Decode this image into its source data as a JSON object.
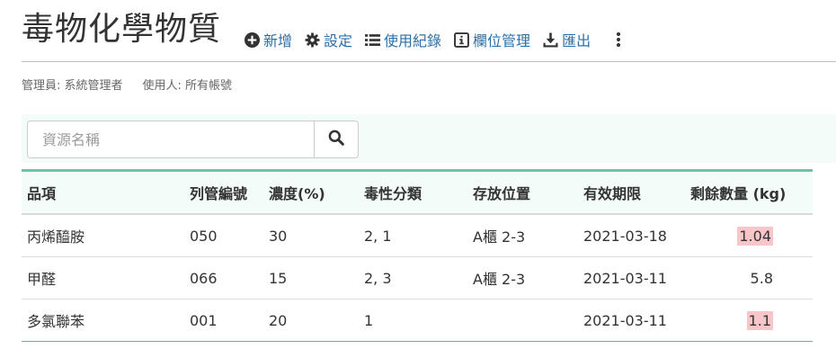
{
  "header": {
    "title": "毒物化學物質"
  },
  "toolbar": {
    "items": [
      {
        "label": "新增",
        "icon": "plus-circle-icon"
      },
      {
        "label": "設定",
        "icon": "gear-icon"
      },
      {
        "label": "使用紀錄",
        "icon": "list-icon"
      },
      {
        "label": "欄位管理",
        "icon": "info-icon"
      },
      {
        "label": "匯出",
        "icon": "download-icon"
      }
    ],
    "more_icon": "vertical-ellipsis-icon"
  },
  "meta": {
    "admin": "管理員: 系統管理者",
    "user": "使用人: 所有帳號"
  },
  "search": {
    "placeholder": "資源名稱",
    "icon": "search-icon"
  },
  "table": {
    "columns": [
      "品項",
      "列管編號",
      "濃度(%)",
      "毒性分類",
      "存放位置",
      "有效期限",
      "剩餘數量 (kg)"
    ],
    "rows": [
      {
        "item": "丙烯醯胺",
        "id": "050",
        "conc": "30",
        "tox": "2, 1",
        "loc": "A櫃 2-3",
        "exp": "2021-03-18",
        "qty": "1.04",
        "low": true
      },
      {
        "item": "甲醛",
        "id": "066",
        "conc": "15",
        "tox": "2, 3",
        "loc": "A櫃 2-3",
        "exp": "2021-03-11",
        "qty": "5.8",
        "low": false
      },
      {
        "item": "多氯聯苯",
        "id": "001",
        "conc": "20",
        "tox": "1",
        "loc": "",
        "exp": "2021-03-11",
        "qty": "1.1",
        "low": true
      }
    ]
  },
  "colors": {
    "accent_link": "#2a6fa8",
    "table_header_bg": "#f3fcf8",
    "table_top_border": "#6cc3a5",
    "low_qty_highlight": "#f8c6c8"
  }
}
